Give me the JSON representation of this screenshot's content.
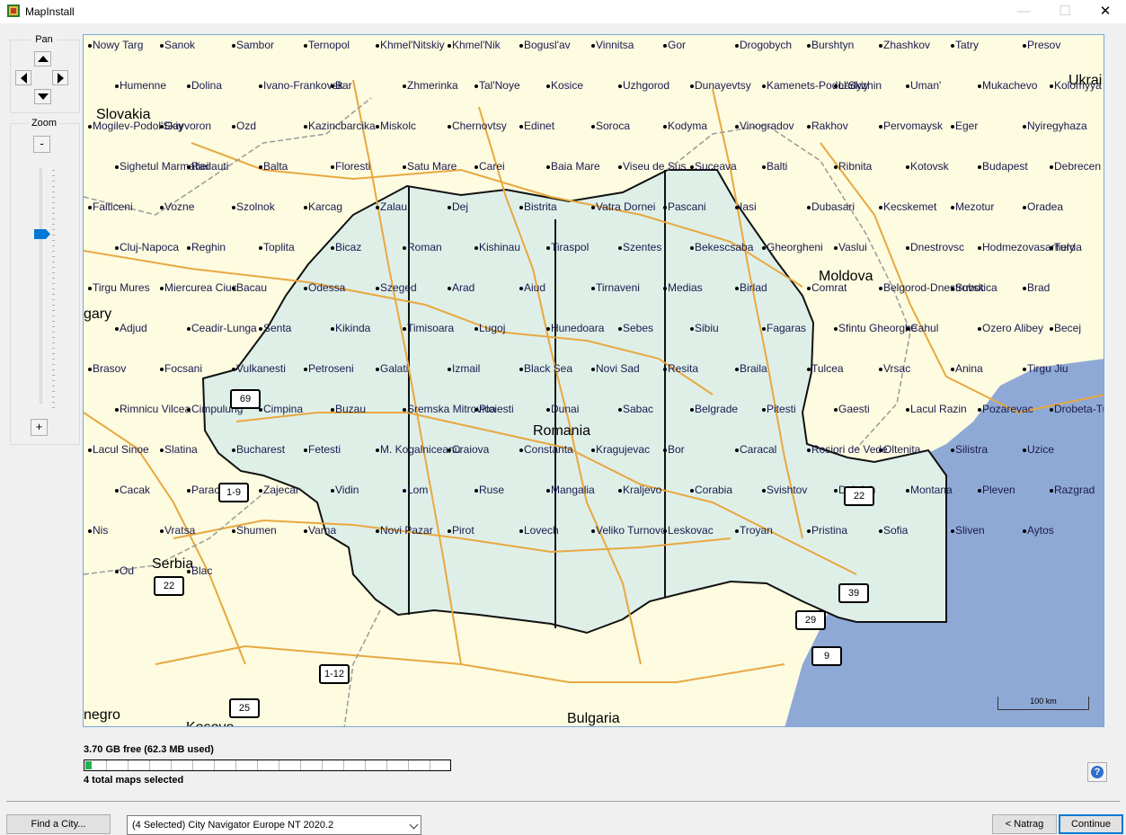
{
  "window": {
    "title": "MapInstall",
    "minimize_glyph": "—",
    "maximize_glyph": "☐",
    "close_glyph": "✕"
  },
  "pan": {
    "label": "Pan"
  },
  "zoom": {
    "label": "Zoom",
    "minus_label": "-",
    "plus_label": "+",
    "level_fraction": 0.28
  },
  "map": {
    "accent_border": "#7aa7d8",
    "country_labels": [
      "Slovakia",
      "Ukrai",
      "Moldova",
      "Romania",
      "Serbia",
      "Bulgaria",
      "gary",
      "Kosovo",
      "negro"
    ],
    "city_labels": [
      "Nowy Targ",
      "Sanok",
      "Sambor",
      "Ternopol",
      "Khmel'Nitskiy",
      "Khmel'Nik",
      "Bogusl'av",
      "Vinnitsa",
      "Gor",
      "Drogobych",
      "Burshtyn",
      "Zhashkov",
      "Tatry",
      "Presov",
      "Humenne",
      "Dolina",
      "Ivano-Frankovsk",
      "Bar",
      "Zhmerinka",
      "Tal'Noye",
      "Kosice",
      "Uzhgorod",
      "Dunayevtsy",
      "Kamenets-Podol'Skiy",
      "Ladyzhin",
      "Uman'",
      "Mukachevo",
      "Kolomyya",
      "Mogilev-Podol'Skiy",
      "Gayvoron",
      "Ozd",
      "Kazincbarcika",
      "Miskolc",
      "Chernovtsy",
      "Edinet",
      "Soroca",
      "Kodyma",
      "Vinogradov",
      "Rakhov",
      "Pervomaysk",
      "Eger",
      "Nyiregyhaza",
      "Sighetul Marmatiei",
      "Radauti",
      "Balta",
      "Floresti",
      "Satu Mare",
      "Carei",
      "Baia Mare",
      "Viseu de Sus",
      "Suceava",
      "Balti",
      "Ribnita",
      "Kotovsk",
      "Budapest",
      "Debrecen",
      "Falticeni",
      "Vozne",
      "Szolnok",
      "Karcag",
      "Zalau",
      "Dej",
      "Bistrita",
      "Vatra Dornei",
      "Pascani",
      "Iasi",
      "Dubasari",
      "Kecskemet",
      "Mezotur",
      "Oradea",
      "Cluj-Napoca",
      "Reghin",
      "Toplita",
      "Bicaz",
      "Roman",
      "Kishinau",
      "Tiraspol",
      "Szentes",
      "Bekescsaba",
      "Gheorgheni",
      "Vaslui",
      "Dnestrovsc",
      "Hodmezovasarhely",
      "Turda",
      "Tirgu Mures",
      "Miercurea Ciuc",
      "Bacau",
      "Odessa",
      "Szeged",
      "Arad",
      "Aiud",
      "Tirnaveni",
      "Medias",
      "Birlad",
      "Comrat",
      "Belgorod-Dnestrovsk",
      "Subotica",
      "Brad",
      "Adjud",
      "Ceadir-Lunga",
      "Senta",
      "Kikinda",
      "Timisoara",
      "Lugoj",
      "Hunedoara",
      "Sebes",
      "Sibiu",
      "Fagaras",
      "Sfintu Gheorghe",
      "Cahul",
      "Ozero Alibey",
      "Becej",
      "Brasov",
      "Focsani",
      "Vulkanesti",
      "Petroseni",
      "Galati",
      "Izmail",
      "Black Sea",
      "Novi Sad",
      "Resita",
      "Braila",
      "Tulcea",
      "Vrsac",
      "Anina",
      "Tirgu Jiu",
      "Rimnicu Vilcea",
      "Cimpulung",
      "Cimpina",
      "Buzau",
      "Sremska Mitrovica",
      "Ploiesti",
      "Dunai",
      "Sabac",
      "Belgrade",
      "Pitesti",
      "Gaesti",
      "Lacul Razin",
      "Pozarevac",
      "Drobeta-Turnu Severin",
      "Lacul Sinoe",
      "Slatina",
      "Bucharest",
      "Fetesti",
      "M. Kogalniceanu",
      "Craiova",
      "Constanta",
      "Kragujevac",
      "Bor",
      "Caracal",
      "Rosiori de Vede",
      "Oltenita",
      "Silistra",
      "Uzice",
      "Cacak",
      "Paracin",
      "Zajecar",
      "Vidin",
      "Lom",
      "Ruse",
      "Mangalia",
      "Kraljevo",
      "Corabia",
      "Svishtov",
      "Dobrich",
      "Montana",
      "Pleven",
      "Razgrad",
      "Nis",
      "Vratsa",
      "Shumen",
      "Varna",
      "Novi Pazar",
      "Pirot",
      "Lovech",
      "Veliko Turnovo",
      "Leskovac",
      "Troyan",
      "Pristina",
      "Sofia",
      "Sliven",
      "Aytos",
      "Od",
      "Blac"
    ],
    "road_shields": [
      "69",
      "22",
      "1-9",
      "22",
      "39",
      "29",
      "9",
      "1-12",
      "25",
      "22"
    ],
    "scale_label": "100 km",
    "colors": {
      "land": "#fdfbe0",
      "selected_region": "#deefe8",
      "water": "#8fa9d6",
      "roads": "#e8a840",
      "borders": "#9a9a9a",
      "country_outline": "#000000"
    }
  },
  "storage": {
    "free_text": "3.70 GB free (62.3 MB used)",
    "used_fraction": 0.017,
    "selected_text": "4 total maps selected"
  },
  "help": {
    "glyph": "?"
  },
  "footer": {
    "find_city_label": "Find a City...",
    "product_select_value": "(4 Selected) City Navigator Europe NT 2020.2",
    "back_label": "< Natrag",
    "continue_label": "Continue"
  }
}
